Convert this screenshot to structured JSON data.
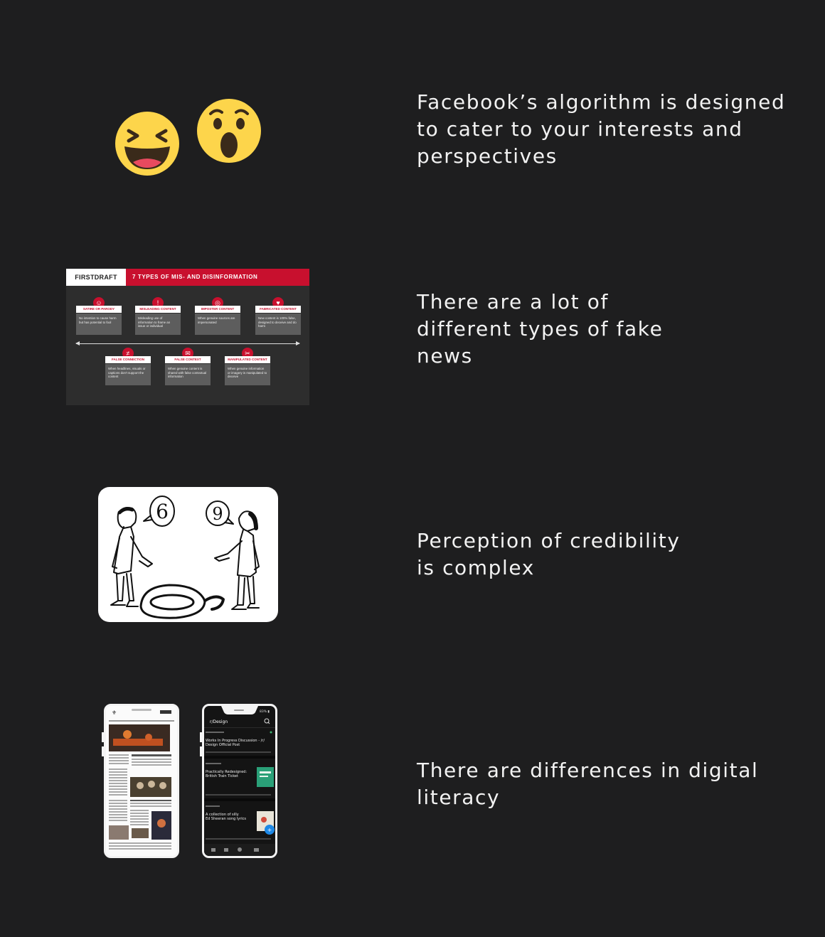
{
  "rows": [
    {
      "caption": "Facebook’s algorithm is designed\nto cater to your interests and\nperspectives",
      "visual": [
        "laughing-emoji",
        "surprised-emoji"
      ]
    },
    {
      "caption": "There are a lot of\ndifferent types of fake\nnews",
      "visual": "infographic"
    },
    {
      "caption": "Perception of credibility\nis complex",
      "visual": "cartoon"
    },
    {
      "caption": "There are differences in digital\nliteracy",
      "visual": [
        "newspaper-phone",
        "reddit-phone"
      ]
    }
  ],
  "infographic": {
    "brand": "FIRSTDRAFT",
    "title": "7 TYPES OF MIS- AND DISINFORMATION",
    "cards": [
      {
        "label": "SATIRE OR PARODY",
        "desc": "No intention to cause harm but has potential to fool",
        "icon": "☺"
      },
      {
        "label": "MISLEADING CONTENT",
        "desc": "Misleading use of information to frame an issue or individual",
        "icon": "!"
      },
      {
        "label": "IMPOSTER CONTENT",
        "desc": "When genuine sources are impersonated",
        "icon": "◎"
      },
      {
        "label": "FABRICATED CONTENT",
        "desc": "New content is 100% false, designed to deceive and do harm",
        "icon": "♥"
      },
      {
        "label": "FALSE CONNECTION",
        "desc": "When headlines, visuals or captions don't support the content",
        "icon": "≠"
      },
      {
        "label": "FALSE CONTEXT",
        "desc": "When genuine content is shared with false contextual information",
        "icon": "✉"
      },
      {
        "label": "MANIPULATED CONTENT",
        "desc": "When genuine information or imagery is manipulated to deceive",
        "icon": "✂"
      }
    ]
  },
  "cartoon": {
    "left_bubble": "6",
    "right_bubble": "9"
  },
  "reddit_phone": {
    "subreddit": "r/Design",
    "posts": [
      "Works In Progress Discussion - /r/ Design Official Post",
      "Practically Redesigned: British Train Ticket",
      "A collection of silly Ed Sheeran song lyrics"
    ]
  },
  "colors": {
    "background": "#1e1e1f",
    "caption_text": "#f2f2f2",
    "emoji_yellow": "#fdd54b",
    "infographic_red": "#c8102e"
  }
}
